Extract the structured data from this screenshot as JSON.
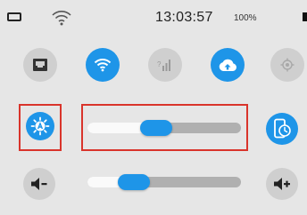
{
  "status_bar": {
    "time": "13:03:57",
    "battery_percent": "100%",
    "icons": [
      "battery-icon",
      "wifi-icon"
    ]
  },
  "quick_toggles": [
    {
      "name": "ethernet",
      "icon": "ethernet-icon",
      "state": "off"
    },
    {
      "name": "wifi",
      "icon": "wifi-icon",
      "state": "on"
    },
    {
      "name": "mobile-data",
      "icon": "signal-bars-icon",
      "state": "off"
    },
    {
      "name": "cloud-sync",
      "icon": "cloud-upload-icon",
      "state": "on"
    },
    {
      "name": "location",
      "icon": "location-icon",
      "state": "off"
    }
  ],
  "brightness": {
    "auto_icon": "auto-brightness-icon",
    "level": 0.45,
    "highlighted": true
  },
  "rotation_lock": {
    "icon": "rotation-lock-icon",
    "state": "on"
  },
  "volume": {
    "down_icon": "volume-down-icon",
    "up_icon": "volume-up-icon",
    "level": 0.3
  },
  "colors": {
    "accent": "#1e95e8",
    "highlight_frame": "#d9342b",
    "background": "#e6e6e6",
    "toggle_off": "#cfcfcf",
    "track": "#b0b0b0",
    "track_fill": "#fafafa"
  }
}
